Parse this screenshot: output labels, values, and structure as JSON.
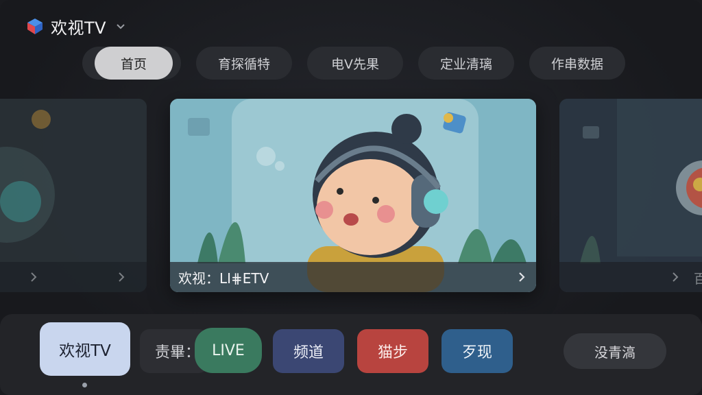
{
  "header": {
    "brand": "欢视TV"
  },
  "tabs": [
    {
      "label": "首页"
    },
    {
      "label": "育探循特"
    },
    {
      "label": "电V先果"
    },
    {
      "label": "定业清璃"
    },
    {
      "label": "作串数据"
    }
  ],
  "carousel": {
    "main_caption": "欢视：LI⋕ETV",
    "right_caption_fragment": "百"
  },
  "dock": {
    "home": "欢视TV",
    "fav": "责畢：",
    "live": "LIVE",
    "channels": "频道",
    "sports": "猫步",
    "discover": "歹现",
    "more": "没青滈"
  },
  "colors": {
    "background": "#1a1b1f",
    "live": "#3a7a5f",
    "channels": "#3b4773",
    "sports": "#b8443f",
    "discover": "#2f5f8c",
    "home_active": "#c9d6ee"
  }
}
